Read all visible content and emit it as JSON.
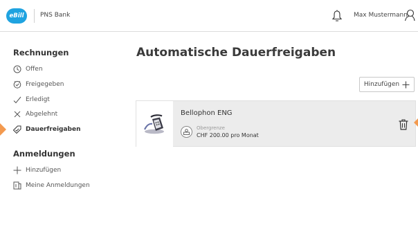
{
  "header": {
    "logo_text": "eBill",
    "bank_name": "PNS Bank",
    "user_name": "Max Mustermann",
    "icons": [
      "bell-icon",
      "user-icon"
    ]
  },
  "sidebar": {
    "rechnungen_title": "Rechnungen",
    "rechnungen_items": [
      {
        "label": "Offen",
        "icon": "clock-icon"
      },
      {
        "label": "Freigegeben",
        "icon": "clock-check-icon"
      },
      {
        "label": "Erledigt",
        "icon": "checkmark-icon"
      },
      {
        "label": "Abgelehnt",
        "icon": "x-icon"
      },
      {
        "label": "Dauerfreigaben",
        "icon": "tag-check-icon",
        "active": true
      }
    ],
    "anmeldungen_title": "Anmeldungen",
    "anmeldungen_items": [
      {
        "label": "Hinzufügen",
        "icon": "plus-icon"
      },
      {
        "label": "Meine Anmeldungen",
        "icon": "document-icon"
      }
    ]
  },
  "main": {
    "title": "Automatische Dauerfreigaben",
    "add_button_label": "Hinzufügen",
    "cards": [
      {
        "name": "Bellophon ENG",
        "limit_label": "Obergrenze",
        "limit_value": "CHF 200.00 pro Monat"
      }
    ]
  },
  "colors": {
    "brand": "#1fa3e0",
    "accent_marker": "#f39a4f",
    "card_background": "#ececec"
  }
}
